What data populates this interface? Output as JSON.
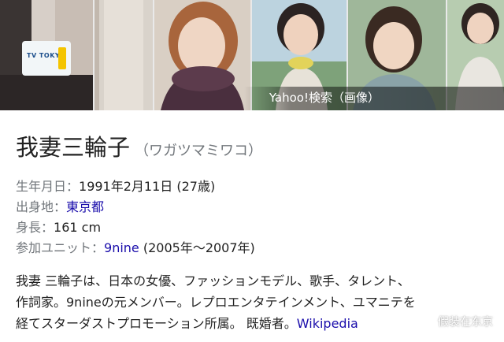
{
  "image_strip": {
    "photos": [
      {
        "name": "photo-1-tv-tokyo",
        "logo_text": "TV TOKYO"
      },
      {
        "name": "photo-2-scarf"
      },
      {
        "name": "photo-3-yellow-scarf"
      },
      {
        "name": "photo-4-bob-hair"
      },
      {
        "name": "photo-5-partial"
      }
    ],
    "overlay_label": "Yahoo!検索（画像）"
  },
  "entity": {
    "name": "我妻三輪子",
    "reading": "（ワガツマミワコ）"
  },
  "facts": [
    {
      "key": "生年月日：",
      "value": "1991年2月11日 (27歳)",
      "link": ""
    },
    {
      "key": "出身地：",
      "value": "",
      "link": "東京都"
    },
    {
      "key": "身長：",
      "value": "161 cm",
      "link": ""
    },
    {
      "key": "参加ユニット：",
      "value": " (2005年〜2007年)",
      "link": "9nine"
    }
  ],
  "description": {
    "line1": "我妻 三輪子は、日本の女優、ファッションモデル、歌手、タレント、",
    "line2": "作詞家。9nineの元メンバー。レプロエンタテインメント、ユマニテを",
    "line3": "経てスターダストプロモーション所属。 既婚者。",
    "source_link": "Wikipedia"
  },
  "watermark": {
    "icon": "wechat-icon",
    "text": "假装在东京"
  }
}
